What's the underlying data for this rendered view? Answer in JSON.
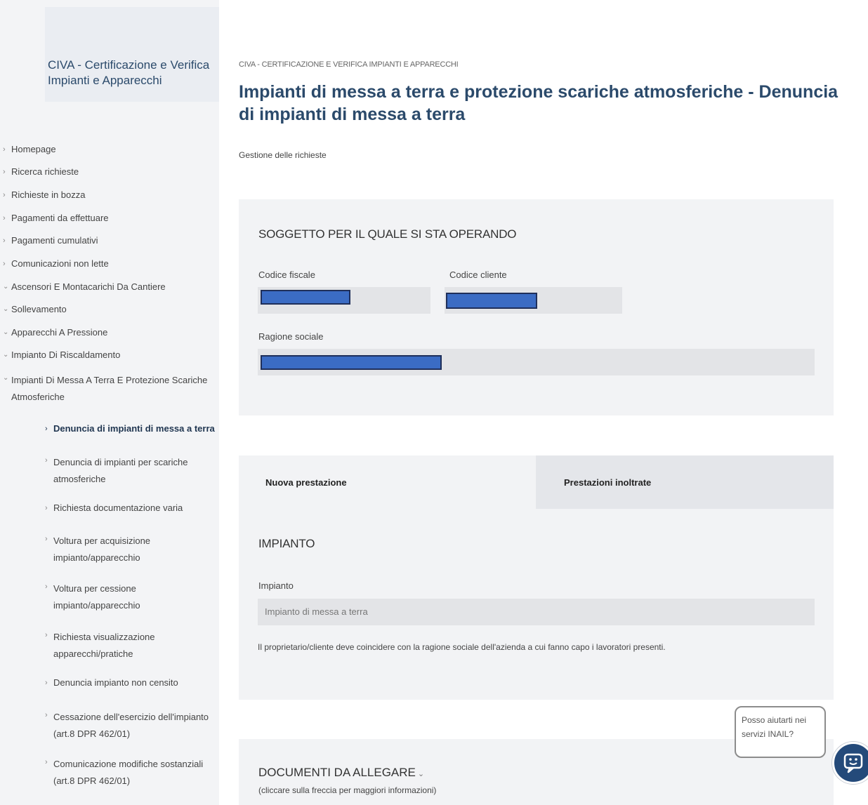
{
  "sidebar": {
    "app_title": "CIVA - Certificazione e Verifica Impianti e Apparecchi",
    "menu": [
      {
        "label": "Homepage"
      },
      {
        "label": "Ricerca richieste"
      },
      {
        "label": "Richieste in bozza"
      },
      {
        "label": "Pagamenti da effettuare"
      },
      {
        "label": "Pagamenti cumulativi"
      },
      {
        "label": "Comunicazioni non lette"
      },
      {
        "label": "Ascensori E Montacarichi Da Cantiere"
      },
      {
        "label": "Sollevamento"
      },
      {
        "label": "Apparecchi A Pressione"
      },
      {
        "label": "Impianto Di Riscaldamento"
      },
      {
        "label": "Impianti Di Messa A Terra E Protezione Scariche Atmosferiche"
      }
    ],
    "submenu": [
      {
        "label": "Denuncia di impianti di messa a terra"
      },
      {
        "label": "Denuncia di impianti per scariche atmosferiche"
      },
      {
        "label": "Richiesta documentazione varia"
      },
      {
        "label": "Voltura per acquisizione impianto/apparecchio"
      },
      {
        "label": "Voltura per cessione impianto/apparecchio"
      },
      {
        "label": "Richiesta visualizzazione apparecchi/pratiche"
      },
      {
        "label": "Denuncia impianto non censito"
      },
      {
        "label": "Cessazione dell'esercizio dell'impianto (art.8 DPR 462/01)"
      },
      {
        "label": "Comunicazione modifiche sostanziali (art.8 DPR 462/01)"
      }
    ]
  },
  "main": {
    "breadcrumb": "CIVA - CERTIFICAZIONE E VERIFICA IMPIANTI E APPARECCHI",
    "title": "Impianti di messa a terra e protezione scariche atmosferiche - Denuncia di impianti di messa a terra",
    "subtitle": "Gestione delle richieste",
    "soggetto": {
      "heading": "SOGGETTO PER IL QUALE SI STA OPERANDO",
      "codice_fiscale_label": "Codice fiscale",
      "codice_cliente_label": "Codice cliente",
      "ragione_sociale_label": "Ragione sociale"
    },
    "tabs": {
      "new": "Nuova prestazione",
      "sent": "Prestazioni inoltrate"
    },
    "impianto": {
      "heading": "IMPIANTO",
      "field_label": "Impianto",
      "field_value": "Impianto di messa a terra",
      "note": "Il proprietario/cliente deve coincidere con la ragione sociale dell'azienda a cui fanno capo i lavoratori presenti."
    },
    "documenti": {
      "heading": "DOCUMENTI DA ALLEGARE",
      "hint": "(cliccare sulla freccia per maggiori informazioni)"
    }
  },
  "chat": {
    "bubble_text": "Posso aiutarti nei servizi INAIL?",
    "icon": "chatbot-icon"
  },
  "colors": {
    "title": "#2b4a6b",
    "panel": "#f2f3f5",
    "redaction": "#3b6cc4",
    "chat_button": "#244a7a"
  }
}
